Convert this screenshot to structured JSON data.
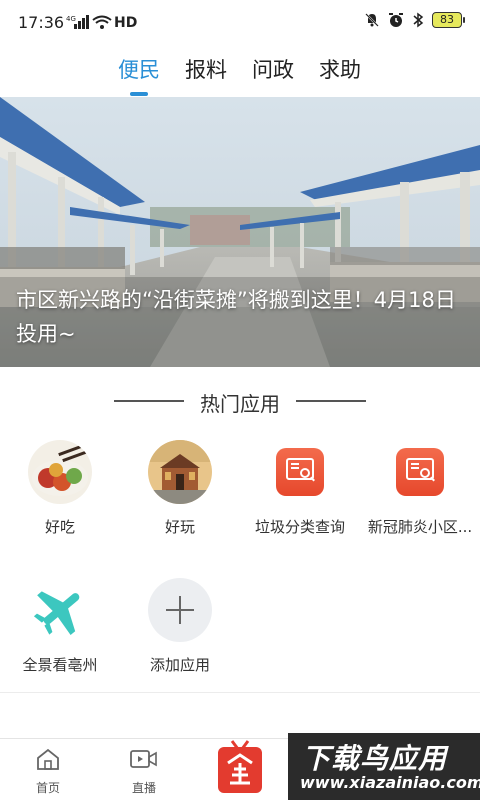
{
  "status_bar": {
    "time": "17:36",
    "network": "4G",
    "hd": "HD",
    "battery": "83"
  },
  "tabs": [
    {
      "label": "便民",
      "active": true
    },
    {
      "label": "报料",
      "active": false
    },
    {
      "label": "问政",
      "active": false
    },
    {
      "label": "求助",
      "active": false
    }
  ],
  "banner": {
    "title": "市区新兴路的“沿街菜摊”将搬到这里！4月18日投用~"
  },
  "hot_apps": {
    "title": "热门应用",
    "items": [
      {
        "label": "好吃",
        "icon": "food-photo-icon"
      },
      {
        "label": "好玩",
        "icon": "landmark-photo-icon"
      },
      {
        "label": "垃圾分类查询",
        "icon": "search-doc-icon"
      },
      {
        "label": "新冠肺炎小区...",
        "icon": "search-doc-icon"
      },
      {
        "label": "全景看亳州",
        "icon": "airplane-icon"
      },
      {
        "label": "添加应用",
        "icon": "plus-icon"
      }
    ]
  },
  "bottom_nav": {
    "items": [
      {
        "label": "首页",
        "icon": "home-icon"
      },
      {
        "label": "直播",
        "icon": "video-icon"
      }
    ]
  },
  "watermark": {
    "main": "下载鸟应用",
    "sub": "www.xiazainiao.com"
  },
  "colors": {
    "accent": "#2a8fd6",
    "app_tile": "#ea5537",
    "plane": "#3cc7bf"
  }
}
